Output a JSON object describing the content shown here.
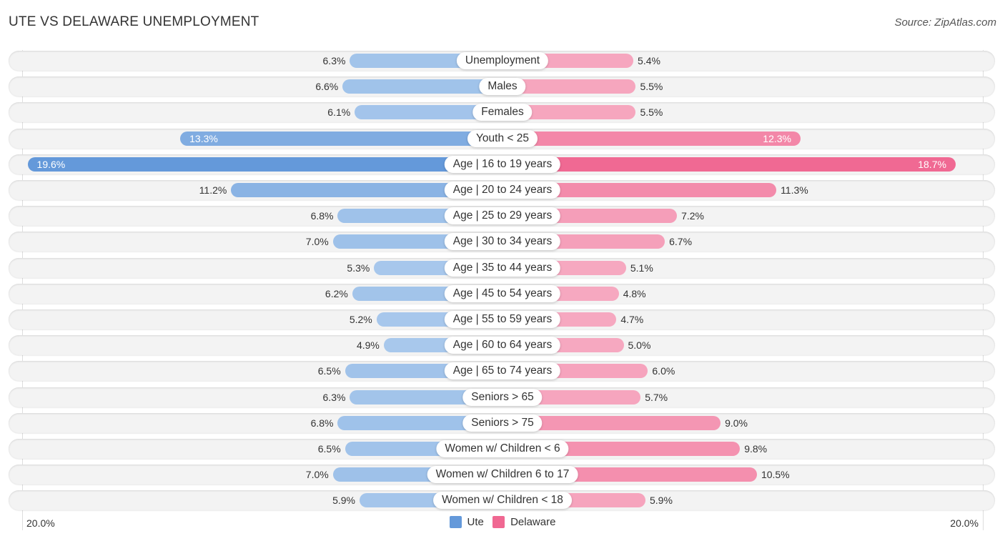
{
  "header": {
    "title": "UTE VS DELAWARE UNEMPLOYMENT",
    "source": "Source: ZipAtlas.com"
  },
  "colors": {
    "ute_light": "#a8c8ec",
    "ute_strong": "#6499da",
    "delaware_light": "#f6a8c0",
    "delaware_strong": "#f06892"
  },
  "legend": {
    "items": [
      {
        "label": "Ute",
        "color": "#6499da"
      },
      {
        "label": "Delaware",
        "color": "#f06892"
      }
    ]
  },
  "axis": {
    "left_label": "20.0%",
    "right_label": "20.0%"
  },
  "chart_data": {
    "type": "bar",
    "orientation": "horizontal-diverging",
    "title": "UTE VS DELAWARE UNEMPLOYMENT",
    "xlabel": "",
    "ylabel": "",
    "xlim": [
      -20,
      20
    ],
    "unit": "%",
    "legend_position": "bottom-center",
    "categories": [
      "Unemployment",
      "Males",
      "Females",
      "Youth < 25",
      "Age | 16 to 19 years",
      "Age | 20 to 24 years",
      "Age | 25 to 29 years",
      "Age | 30 to 34 years",
      "Age | 35 to 44 years",
      "Age | 45 to 54 years",
      "Age | 55 to 59 years",
      "Age | 60 to 64 years",
      "Age | 65 to 74 years",
      "Seniors > 65",
      "Seniors > 75",
      "Women w/ Children < 6",
      "Women w/ Children 6 to 17",
      "Women w/ Children < 18"
    ],
    "series": [
      {
        "name": "Ute",
        "side": "left",
        "values": [
          6.3,
          6.6,
          6.1,
          13.3,
          19.6,
          11.2,
          6.8,
          7.0,
          5.3,
          6.2,
          5.2,
          4.9,
          6.5,
          6.3,
          6.8,
          6.5,
          7.0,
          5.9
        ],
        "labels": [
          "6.3%",
          "6.6%",
          "6.1%",
          "13.3%",
          "19.6%",
          "11.2%",
          "6.8%",
          "7.0%",
          "5.3%",
          "6.2%",
          "5.2%",
          "4.9%",
          "6.5%",
          "6.3%",
          "6.8%",
          "6.5%",
          "7.0%",
          "5.9%"
        ]
      },
      {
        "name": "Delaware",
        "side": "right",
        "values": [
          5.4,
          5.5,
          5.5,
          12.3,
          18.7,
          11.3,
          7.2,
          6.7,
          5.1,
          4.8,
          4.7,
          5.0,
          6.0,
          5.7,
          9.0,
          9.8,
          10.5,
          5.9
        ],
        "labels": [
          "5.4%",
          "5.5%",
          "5.5%",
          "12.3%",
          "18.7%",
          "11.3%",
          "7.2%",
          "6.7%",
          "5.1%",
          "4.8%",
          "4.7%",
          "5.0%",
          "6.0%",
          "5.7%",
          "9.0%",
          "9.8%",
          "10.5%",
          "5.9%"
        ]
      }
    ],
    "tick_labels": [
      "20.0%",
      "20.0%"
    ]
  }
}
